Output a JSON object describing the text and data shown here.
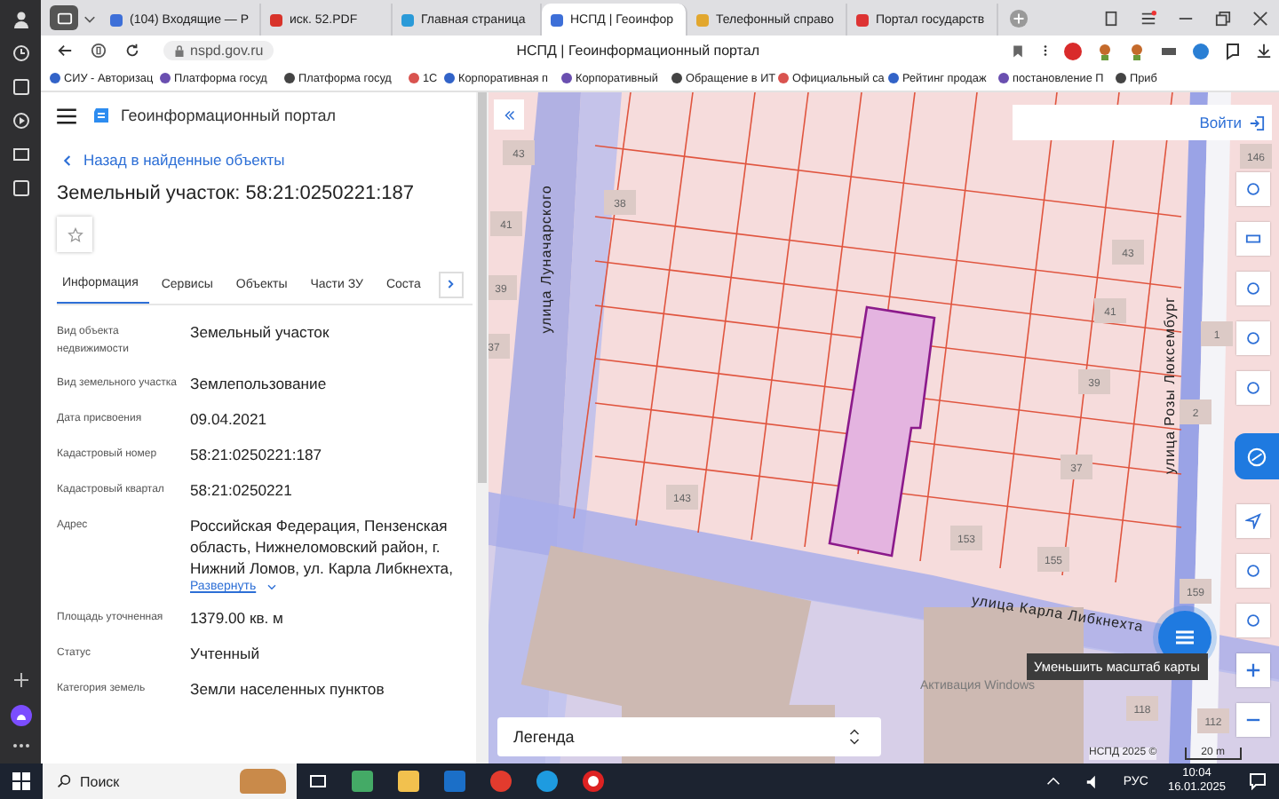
{
  "browser": {
    "tabs": [
      {
        "label": "(104) Входящие — Р",
        "selected": false
      },
      {
        "label": "иск. 52.PDF",
        "selected": false
      },
      {
        "label": "Главная страница",
        "selected": false
      },
      {
        "label": "НСПД | Геоинфор",
        "selected": true
      },
      {
        "label": "Телефонный справо",
        "selected": false
      },
      {
        "label": "Портал государств",
        "selected": false
      }
    ],
    "address": "nspd.gov.ru",
    "page_title": "НСПД | Геоинформационный портал",
    "bookmarks": [
      "СИУ - Авторизац",
      "Платформа госуд",
      "Платформа госуд",
      "1С",
      "Корпоративная п",
      "Корпоративный",
      "Обращение в ИТ",
      "Официальный са",
      "Рейтинг продаж",
      "постановление П",
      "Приб"
    ]
  },
  "panel": {
    "portal_name": "Геоинформационный портал",
    "back_link": "Назад в найденные объекты",
    "title": "Земельный участок: 58:21:0250221:187",
    "tabs": [
      {
        "label": "Информация",
        "selected": true
      },
      {
        "label": "Сервисы",
        "selected": false
      },
      {
        "label": "Объекты",
        "selected": false
      },
      {
        "label": "Части ЗУ",
        "selected": false
      },
      {
        "label": "Соста",
        "selected": false
      }
    ],
    "fields": [
      {
        "label": "Вид объекта недвижимости",
        "value": "Земельный участок"
      },
      {
        "label": "Вид земельного участка",
        "value": "Землепользование"
      },
      {
        "label": "Дата присвоения",
        "value": "09.04.2021"
      },
      {
        "label": "Кадастровый номер",
        "value": "58:21:0250221:187"
      },
      {
        "label": "Кадастровый квартал",
        "value": "58:21:0250221"
      },
      {
        "label": "Адрес",
        "value": "Российская Федерация, Пензенская область, Нижнеломовский район, г. Нижний Ломов, ул. Карла Либкнехта,",
        "expand": "Развернуть"
      },
      {
        "label": "Площадь уточненная",
        "value": "1379.00 кв. м"
      },
      {
        "label": "Статус",
        "value": "Учтенный"
      },
      {
        "label": "Категория земель",
        "value": "Земли населенных пунктов"
      }
    ]
  },
  "map": {
    "login": "Войти",
    "streets": [
      "улица Луначарского",
      "улица Розы Люксембург",
      "улица Карла Либкнехта"
    ],
    "house_numbers": [
      "43",
      "38",
      "41",
      "39",
      "37",
      "43",
      "41",
      "39",
      "1",
      "2",
      "146",
      "37",
      "143",
      "153",
      "155",
      "159",
      "118",
      "112"
    ],
    "tooltip": "Уменьшить масштаб карты",
    "legend": "Легенда",
    "os_notice": "Активация Windows",
    "copyright": "НСПД 2025 ©",
    "scale": "20 m"
  },
  "taskbar": {
    "search": "Поиск",
    "language": "РУС",
    "time": "10:04",
    "date": "16.01.2025"
  }
}
